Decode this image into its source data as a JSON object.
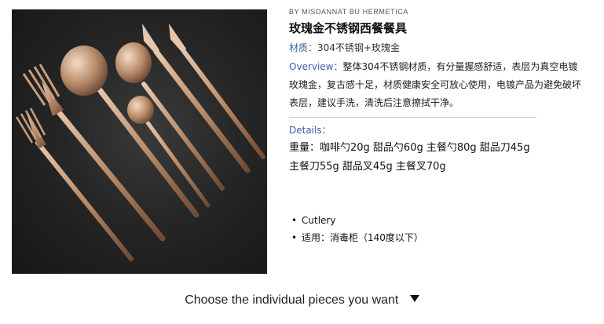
{
  "brand": "BY MISDANNAT BU HERMETICA",
  "product": {
    "title": "玫瑰金不锈钢西餐餐具",
    "material_label": "材质：",
    "material_value": "304不锈钢+玫瑰金",
    "overview_label": "Overview：",
    "overview_text": "整体304不锈钢材质，有分量握感舒适，表层为真空电镀玫瑰金，复古感十足，材质健康安全可放心使用，电镀产品为避免破坏表层，建议手洗，清洗后注意擦拭干净。",
    "details_label": "Details：",
    "weights_line1": "重量：咖啡勺20g 甜品勺60g 主餐勺80g 甜品刀45g",
    "weights_line2": "主餐刀55g 甜品叉45g 主餐叉70g"
  },
  "bullets": [
    "Cutlery",
    "适用：消毒柜（140度以下）"
  ],
  "choose": {
    "label": "Choose the individual pieces you want",
    "icon": "triangle-down-icon"
  },
  "colors": {
    "accent_blue": "#3a5f9f",
    "rose_gold": "#b98c69",
    "background_dark": "#262626"
  }
}
